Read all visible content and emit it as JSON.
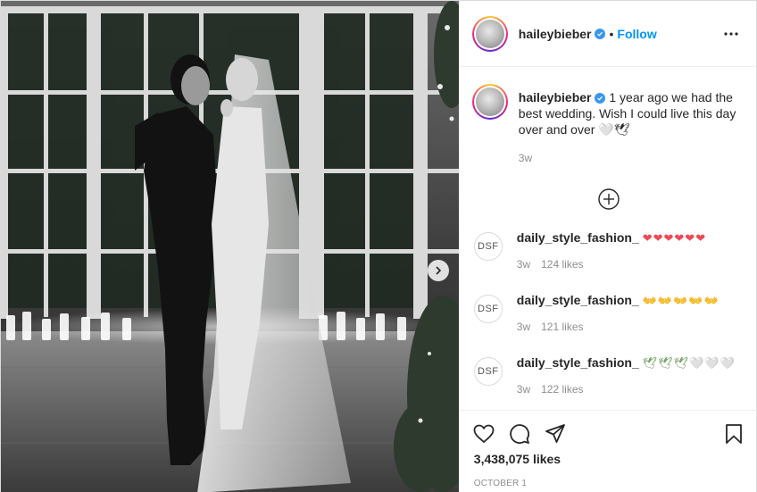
{
  "post": {
    "username": "haileybieber",
    "follow_label": "Follow",
    "separator": "•",
    "caption_text": "1 year ago we had the best wedding. Wish I could live this day over and over 🤍🕊",
    "caption_time": "3w",
    "likes": "3,438,075 likes",
    "date": "OCTOBER 1"
  },
  "comments": [
    {
      "avatar_text": "DSF",
      "username": "daily_style_fashion_",
      "text": "❤❤❤❤❤❤",
      "time": "3w",
      "likes": "124 likes"
    },
    {
      "avatar_text": "DSF",
      "username": "daily_style_fashion_",
      "text": "👐👐👐👐👐",
      "time": "3w",
      "likes": "121 likes"
    },
    {
      "avatar_text": "DSF",
      "username": "daily_style_fashion_",
      "text": "🕊🕊🕊🤍🤍🤍",
      "time": "3w",
      "likes": "122 likes"
    }
  ],
  "icons": {
    "verified": "verified-badge-icon",
    "more": "more-options-icon",
    "load_more": "plus-circle-icon",
    "like": "heart-outline-icon",
    "comment": "comment-bubble-icon",
    "share": "paper-plane-icon",
    "save": "bookmark-icon",
    "next": "chevron-right-icon"
  },
  "colors": {
    "link": "#0095f6",
    "verified": "#3897f0",
    "muted": "#8e8e8e",
    "text": "#262626"
  }
}
